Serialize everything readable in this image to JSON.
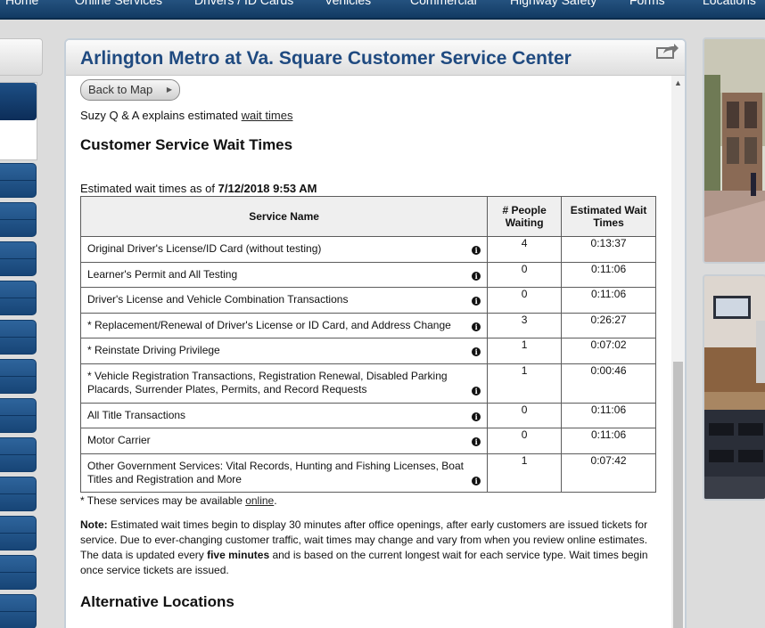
{
  "nav": {
    "items": [
      "Home",
      "Online Services",
      "Drivers / ID Cards",
      "Vehicles",
      "Commercial",
      "Highway Safety",
      "Forms",
      "Locations"
    ]
  },
  "colors": {
    "nav_bg": "#1b4672",
    "title": "#1f4a80",
    "sidebar_button": "#214f82"
  },
  "page": {
    "title": "Arlington Metro at Va. Square Customer Service Center",
    "share_icon": "share-icon",
    "back_label": "Back to Map",
    "intro_prefix": "Suzy Q & A explains estimated ",
    "intro_link": "wait times",
    "wait_heading": "Customer Service Wait Times",
    "asof_prefix": "Estimated wait times as of ",
    "asof_value": "7/12/2018 9:53 AM",
    "alt_heading": "Alternative Locations"
  },
  "table": {
    "headers": {
      "service": "Service Name",
      "people": "# People Waiting",
      "wait": "Estimated Wait Times"
    },
    "rows": [
      {
        "service": "Original Driver's License/ID Card (without testing)",
        "people": "4",
        "wait": "0:13:37"
      },
      {
        "service": "Learner's Permit and All Testing",
        "people": "0",
        "wait": "0:11:06"
      },
      {
        "service": "Driver's License and Vehicle Combination Transactions",
        "people": "0",
        "wait": "0:11:06"
      },
      {
        "service": "* Replacement/Renewal of Driver's License or ID Card, and Address Change",
        "people": "3",
        "wait": "0:26:27"
      },
      {
        "service": "* Reinstate Driving Privilege",
        "people": "1",
        "wait": "0:07:02"
      },
      {
        "service": "* Vehicle Registration Transactions, Registration Renewal, Disabled Parking Placards, Surrender Plates, Permits, and Record Requests",
        "people": "1",
        "wait": "0:00:46"
      },
      {
        "service": "All Title Transactions",
        "people": "0",
        "wait": "0:11:06"
      },
      {
        "service": "Motor Carrier",
        "people": "0",
        "wait": "0:11:06"
      },
      {
        "service": "Other Government Services: Vital Records, Hunting and Fishing Licenses, Boat Titles and Registration and More",
        "people": "1",
        "wait": "0:07:42"
      }
    ]
  },
  "footnote": {
    "prefix": "* These services may be available ",
    "link": "online",
    "suffix": "."
  },
  "note": {
    "label": "Note:",
    "text1": " Estimated wait times begin to display 30 minutes after office openings, after early customers are issued tickets for service. Due to ever-changing customer traffic, wait times may change and vary from when you review online estimates. The data is updated every ",
    "bold": "five minutes",
    "text2": " and is based on the current longest wait for each service type. Wait times begin once service tickets are issued."
  }
}
